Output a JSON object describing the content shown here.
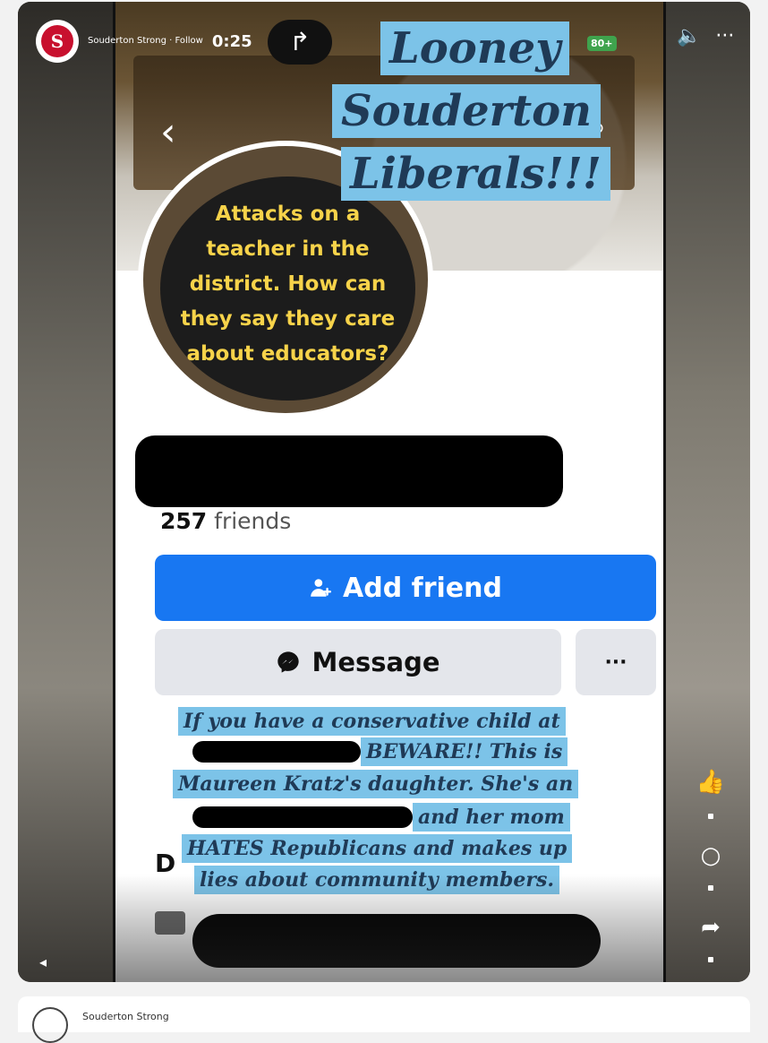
{
  "source": {
    "page_name": "Souderton Strong",
    "follow_label": "Follow",
    "timer": "0:25",
    "battery": "80+"
  },
  "headline": {
    "line1": "Looney",
    "line2": "Souderton",
    "line3": "Liberals!!!"
  },
  "caption": "Attacks on a teacher in the district.  How can they say they care about educators?",
  "profile": {
    "friends_count": "257",
    "friends_label": "friends",
    "add_friend_label": "Add friend",
    "message_label": "Message",
    "more_label": "···",
    "section_initial": "D"
  },
  "warning": {
    "line1": "If you have a conservative child at",
    "line2": "BEWARE!! This is",
    "line3": "Maureen Kratz's daughter. She's an",
    "line4": "and her mom",
    "line5": "HATES Republicans and makes up",
    "line6": "lies about community members."
  },
  "icons": {
    "back": "chevron-left-icon",
    "search": "search-icon",
    "share": "share-arrow-icon",
    "mute": "mute-icon",
    "more": "more-icon",
    "like": "thumbs-up-icon",
    "comment": "comment-icon",
    "forward": "forward-icon",
    "add_friend": "add-person-icon",
    "messenger": "messenger-icon"
  },
  "footer": {
    "page_name": "Souderton Strong"
  },
  "colors": {
    "facebook_blue": "#1877f2",
    "highlight_blue": "#7cc3e8",
    "caption_yellow": "#f7d34a"
  }
}
